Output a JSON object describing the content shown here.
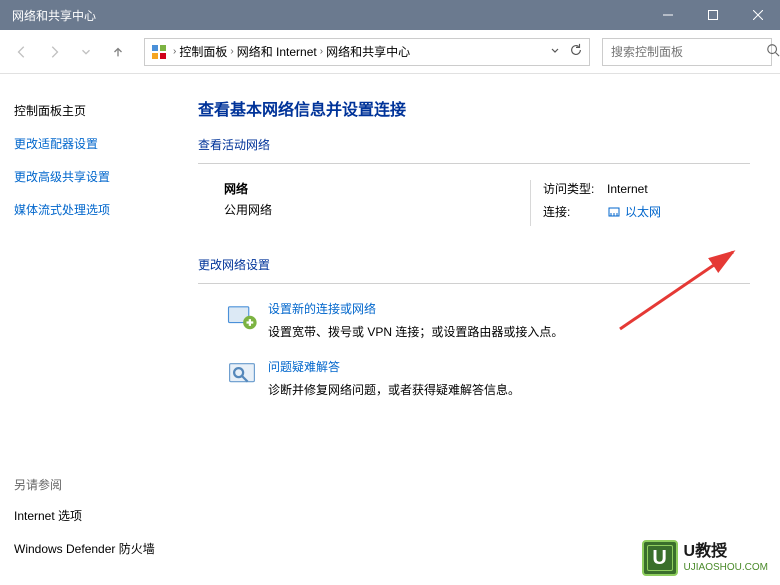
{
  "titlebar": {
    "title": "网络和共享中心"
  },
  "nav": {
    "breadcrumb": [
      "控制面板",
      "网络和 Internet",
      "网络和共享中心"
    ]
  },
  "search": {
    "placeholder": "搜索控制面板"
  },
  "sidebar": {
    "home": "控制面板主页",
    "items": [
      "更改适配器设置",
      "更改高级共享设置",
      "媒体流式处理选项"
    ],
    "see_also_label": "另请参阅",
    "see_also": [
      "Internet 选项",
      "Windows Defender 防火墙"
    ]
  },
  "main": {
    "title": "查看基本网络信息并设置连接",
    "active_networks_label": "查看活动网络",
    "network": {
      "name": "网络",
      "type": "公用网络",
      "access_label": "访问类型:",
      "access_value": "Internet",
      "conn_label": "连接:",
      "conn_value": "以太网"
    },
    "change_settings_label": "更改网络设置",
    "setup": {
      "title": "设置新的连接或网络",
      "desc": "设置宽带、拨号或 VPN 连接；或设置路由器或接入点。"
    },
    "troubleshoot": {
      "title": "问题疑难解答",
      "desc": "诊断并修复网络问题，或者获得疑难解答信息。"
    }
  },
  "watermark": {
    "letter": "U",
    "name": "U教授",
    "url": "UJIAOSHOU.COM"
  }
}
